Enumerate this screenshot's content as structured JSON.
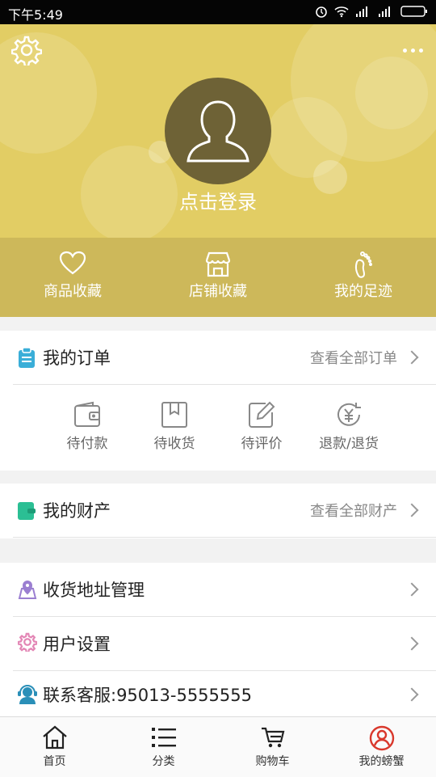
{
  "status_bar": {
    "time": "下午5:49"
  },
  "header": {
    "login_text": "点击登录"
  },
  "quick_links": [
    {
      "label": "商品收藏",
      "icon": "heart-icon"
    },
    {
      "label": "店铺收藏",
      "icon": "store-icon"
    },
    {
      "label": "我的足迹",
      "icon": "footprint-icon"
    }
  ],
  "orders": {
    "title": "我的订单",
    "link": "查看全部订单",
    "items": [
      {
        "label": "待付款",
        "icon": "wallet-icon"
      },
      {
        "label": "待收货",
        "icon": "box-icon"
      },
      {
        "label": "待评价",
        "icon": "edit-icon"
      },
      {
        "label": "退款/退货",
        "icon": "refund-icon"
      }
    ]
  },
  "assets": {
    "title": "我的财产",
    "link": "查看全部财产"
  },
  "menu": [
    {
      "label": "收货地址管理",
      "icon": "map-icon",
      "color": "#9b7fd1"
    },
    {
      "label": "用户设置",
      "icon": "gear-icon",
      "color": "#e386b5"
    },
    {
      "label": "联系客服:95013-5555555",
      "icon": "support-icon",
      "color": "#2a8fb8"
    }
  ],
  "tabs": [
    {
      "label": "首页",
      "icon": "home-icon"
    },
    {
      "label": "分类",
      "icon": "list-icon"
    },
    {
      "label": "购物车",
      "icon": "cart-icon"
    },
    {
      "label": "我的螃蟹",
      "icon": "user-icon",
      "active": true
    }
  ],
  "colors": {
    "accent": "#d9382c",
    "header": "#e2cd64",
    "header_band": "#cdb85a"
  }
}
